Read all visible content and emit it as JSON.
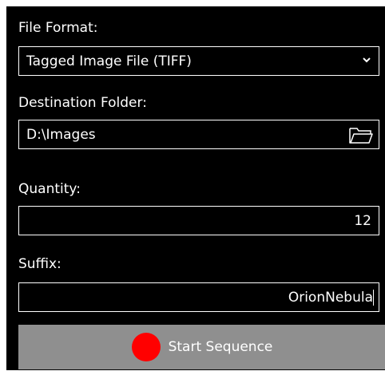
{
  "form": {
    "file_format_label": "File Format:",
    "file_format_value": "Tagged Image File (TIFF)",
    "destination_label": "Destination Folder:",
    "destination_value": "D:\\Images",
    "quantity_label": "Quantity:",
    "quantity_value": "12",
    "suffix_label": "Suffix:",
    "suffix_value": "OrionNebula"
  },
  "actions": {
    "start_label": "Start Sequence"
  },
  "icons": {
    "dropdown": "chevron-down-icon",
    "folder": "folder-icon",
    "record": "record-dot-icon"
  },
  "colors": {
    "background": "#000000",
    "text": "#ffffff",
    "button": "#8f8f8f",
    "record": "#ff0000"
  }
}
